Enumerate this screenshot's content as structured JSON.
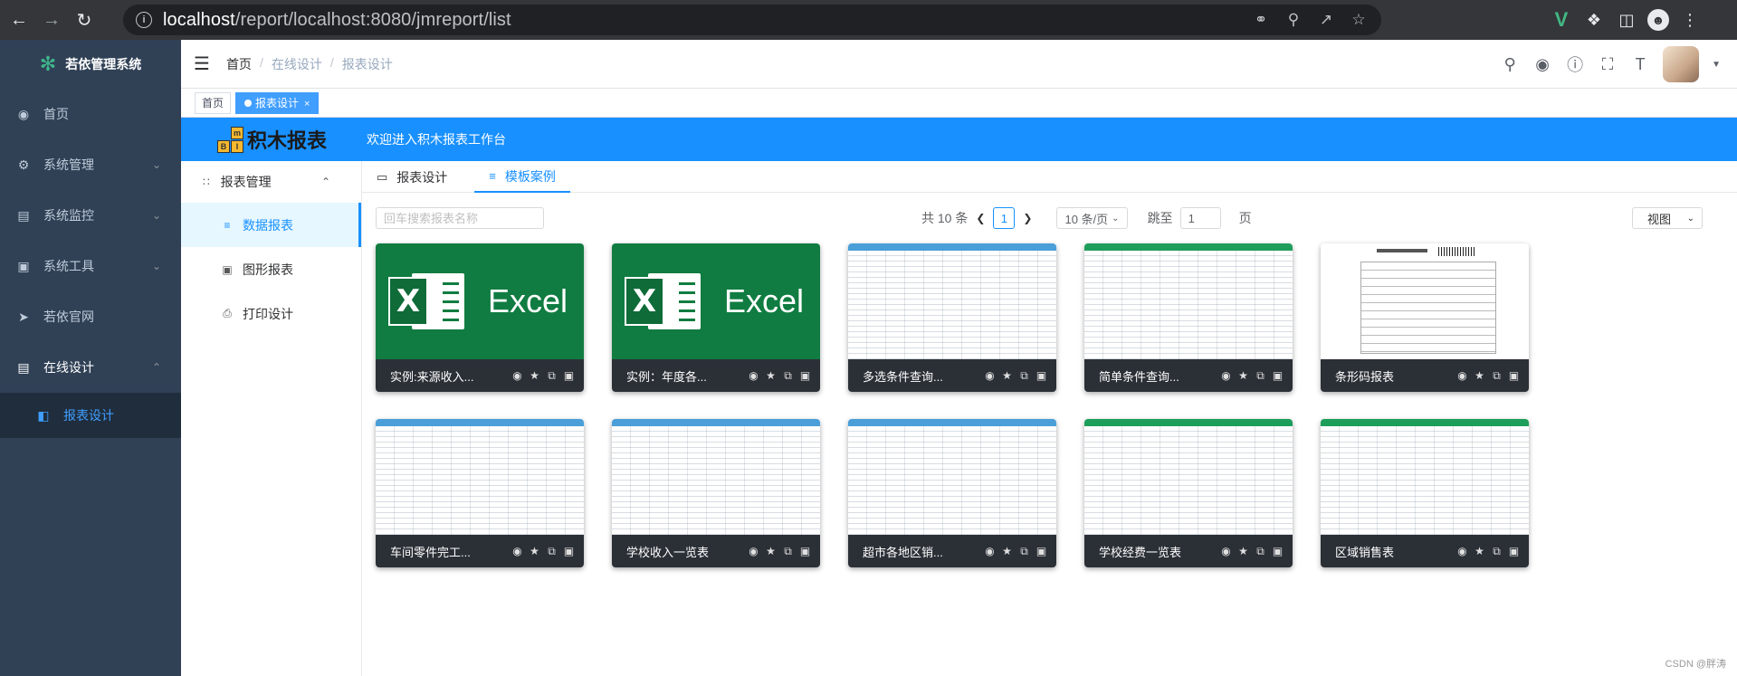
{
  "browser": {
    "url_host": "localhost",
    "url_path": "/report/localhost:8080/jmreport/list",
    "url_info_icon": "info-icon"
  },
  "sidebar": {
    "app_title": "若依管理系统",
    "items": [
      {
        "label": "首页",
        "icon": "dashboard-icon"
      },
      {
        "label": "系统管理",
        "icon": "gear-icon",
        "arrow": "chevron-down-icon"
      },
      {
        "label": "系统监控",
        "icon": "monitor-icon",
        "arrow": "chevron-down-icon"
      },
      {
        "label": "系统工具",
        "icon": "toolbox-icon",
        "arrow": "chevron-down-icon"
      },
      {
        "label": "若依官网",
        "icon": "send-icon"
      },
      {
        "label": "在线设计",
        "icon": "document-icon",
        "arrow": "chevron-up-icon"
      }
    ],
    "subitem": {
      "label": "报表设计",
      "icon": "report-icon"
    }
  },
  "header": {
    "breadcrumb": [
      "首页",
      "在线设计",
      "报表设计"
    ]
  },
  "tags": {
    "home": "首页",
    "active": "报表设计",
    "close": "×"
  },
  "jm": {
    "logo_text": "积木报表",
    "logo_blocks": [
      "m",
      "B",
      "I"
    ],
    "welcome": "欢迎进入积木报表工作台",
    "nav_group": "报表管理",
    "nav_items": [
      "数据报表",
      "图形报表",
      "打印设计"
    ],
    "tabs": [
      "报表设计",
      "模板案例"
    ],
    "search_placeholder": "回车搜索报表名称",
    "pager": {
      "total": "共 10 条",
      "current": "1",
      "page_size": "10 条/页",
      "jump_label": "跳至",
      "jump_value": "1",
      "page_suffix": "页"
    },
    "view_label": "视图"
  },
  "cards": [
    {
      "title": "实例:来源收入...",
      "thumb": "excel"
    },
    {
      "title": "实例：年度各...",
      "thumb": "excel"
    },
    {
      "title": "多选条件查询...",
      "thumb": "sheet-blue"
    },
    {
      "title": "简单条件查询...",
      "thumb": "sheet-green"
    },
    {
      "title": "条形码报表",
      "thumb": "barcode"
    },
    {
      "title": "车间零件完工...",
      "thumb": "sheet-blue"
    },
    {
      "title": "学校收入一览表",
      "thumb": "sheet-blue"
    },
    {
      "title": "超市各地区销...",
      "thumb": "sheet-blue"
    },
    {
      "title": "学校经费一览表",
      "thumb": "sheet-green"
    },
    {
      "title": "区域销售表",
      "thumb": "sheet-green"
    }
  ],
  "excel_word": "Excel",
  "excel_letter": "X",
  "watermark": "CSDN @胖涛",
  "colors": {
    "sidebar_bg": "#304156",
    "accent": "#1890ff",
    "excel_green": "#107c41"
  }
}
